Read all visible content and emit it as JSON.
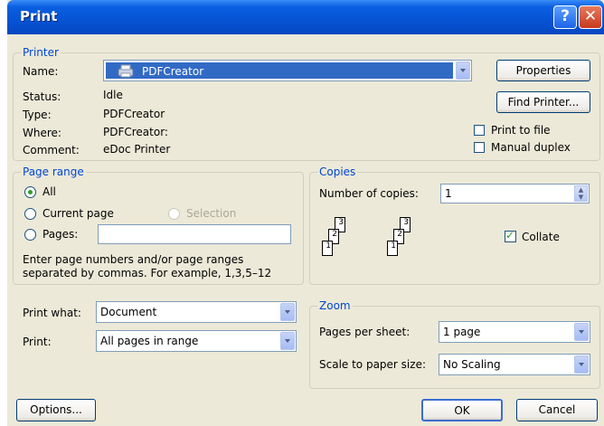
{
  "window": {
    "title": "Print"
  },
  "printer": {
    "legend": "Printer",
    "name_label": "Name:",
    "name_value": "PDFCreator",
    "status_label": "Status:",
    "status_value": "Idle",
    "type_label": "Type:",
    "type_value": "PDFCreator",
    "where_label": "Where:",
    "where_value": "PDFCreator:",
    "comment_label": "Comment:",
    "comment_value": "eDoc Printer",
    "properties_label": "Properties",
    "find_printer_label": "Find Printer...",
    "print_to_file_label": "Print to file",
    "manual_duplex_label": "Manual duplex"
  },
  "page_range": {
    "legend": "Page range",
    "all_label": "All",
    "current_page_label": "Current page",
    "selection_label": "Selection",
    "pages_label": "Pages:",
    "pages_value": "",
    "hint": "Enter page numbers and/or page ranges separated by commas.  For example, 1,3,5–12",
    "selected": "All"
  },
  "copies": {
    "legend": "Copies",
    "number_label": "Number of copies:",
    "number_value": "1",
    "collate_label": "Collate",
    "collate_checked": true,
    "page_numbers": [
      "1",
      "2",
      "3"
    ]
  },
  "print_what": {
    "label": "Print what:",
    "value": "Document"
  },
  "print": {
    "label": "Print:",
    "value": "All pages in range"
  },
  "zoom": {
    "legend": "Zoom",
    "pages_per_sheet_label": "Pages per sheet:",
    "pages_per_sheet_value": "1 page",
    "scale_label": "Scale to paper size:",
    "scale_value": "No Scaling"
  },
  "footer": {
    "options_label": "Options...",
    "ok_label": "OK",
    "cancel_label": "Cancel"
  },
  "colors": {
    "title_bar": "#0653d4",
    "legend_text": "#0046d5",
    "dialog_bg": "#ece9d8",
    "selected_row": "#316ac5"
  }
}
